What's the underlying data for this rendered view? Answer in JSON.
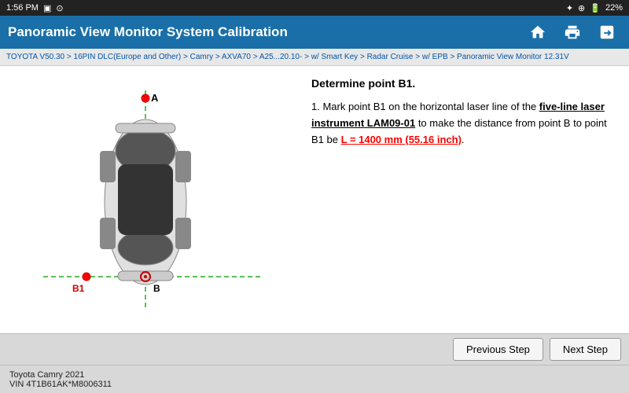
{
  "status_bar": {
    "time": "1:56 PM",
    "battery": "22%"
  },
  "title_bar": {
    "title": "Panoramic View Monitor System Calibration"
  },
  "breadcrumb": {
    "text": "TOYOTA V50.30 > 16PIN DLC(Europe and Other) > Camry > AXVA70 > A25...20.10- > w/ Smart Key > Radar Cruise > w/ EPB > Panoramic View Monitor  12.31V"
  },
  "instructions": {
    "title": "Determine point B1.",
    "step_number": "1.",
    "text_before_laser": " Mark point B1 on the horizontal laser line of the ",
    "laser_text": "five-line laser instrument LAM09-01",
    "text_after_laser": " to make the distance from point B to point B1 be ",
    "measurement": "L = 1400 mm (55.16 inch)",
    "text_end": "."
  },
  "diagram": {
    "point_a_label": "A",
    "point_b1_label": "B1",
    "point_b_label": "B"
  },
  "buttons": {
    "previous": "Previous Step",
    "next": "Next Step"
  },
  "footer": {
    "model": "Toyota Camry 2021",
    "vin": "VIN 4T1B61AK*M8006311"
  },
  "icons": {
    "home": "⌂",
    "print": "🖨",
    "export": "↗"
  }
}
